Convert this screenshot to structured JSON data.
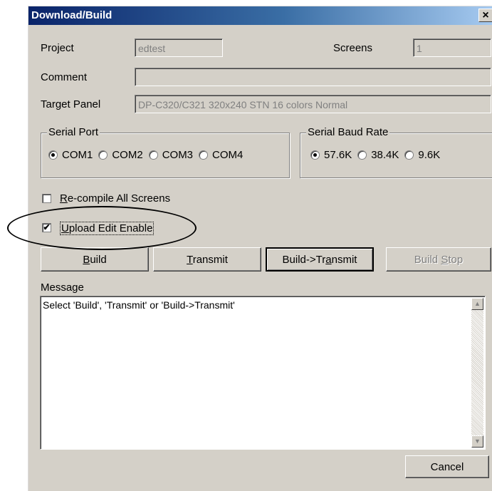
{
  "window": {
    "title": "Download/Build",
    "close_glyph": "×"
  },
  "fields": {
    "project_label": "Project",
    "project_value": "edtest",
    "screens_label": "Screens",
    "screens_value": "1",
    "comment_label": "Comment",
    "comment_value": "",
    "target_label": "Target Panel",
    "target_value": "DP-C320/C321 320x240 STN 16 colors Normal"
  },
  "serial_port": {
    "title": "Serial Port",
    "options": [
      "COM1",
      "COM2",
      "COM3",
      "COM4"
    ],
    "selected": "COM1"
  },
  "baud_rate": {
    "title": "Serial Baud Rate",
    "options": [
      "57.6K",
      "38.4K",
      "9.6K"
    ],
    "selected": "57.6K"
  },
  "options": {
    "recompile_label_prefix": "R",
    "recompile_label_rest": "e-compile All Screens",
    "recompile_checked": false,
    "upload_label_prefix": "U",
    "upload_label_rest": "pload Edit Enable",
    "upload_checked": true,
    "check_mark": "✔"
  },
  "buttons": {
    "build_key": "B",
    "build_rest": "uild",
    "transmit_key": "T",
    "transmit_rest": "ransmit",
    "build_transmit_pre": "Build->Tr",
    "build_transmit_key": "a",
    "build_transmit_post": "nsmit",
    "build_stop_pre": "Build ",
    "build_stop_key": "S",
    "build_stop_post": "top",
    "cancel": "Cancel"
  },
  "message": {
    "label": "Message",
    "text": "Select 'Build', 'Transmit' or 'Build->Transmit'"
  },
  "icons": {
    "scroll_up": "▲",
    "scroll_down": "▼"
  }
}
